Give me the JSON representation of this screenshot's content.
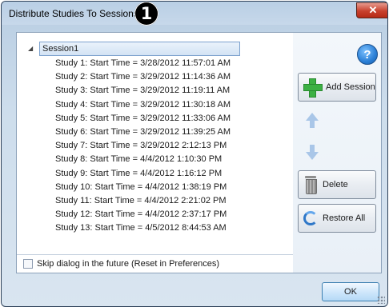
{
  "window": {
    "title": "Distribute Studies To Sessions",
    "badge": "1",
    "close_symbol": "✕"
  },
  "tree": {
    "root_label": "Session1",
    "expander_symbol": "◢",
    "studies": [
      "Study 1: Start Time = 3/28/2012 11:57:01 AM",
      "Study 2: Start Time = 3/29/2012 11:14:36 AM",
      "Study 3: Start Time = 3/29/2012 11:19:11 AM",
      "Study 4: Start Time = 3/29/2012 11:30:18 AM",
      "Study 5: Start Time = 3/29/2012 11:33:06 AM",
      "Study 6: Start Time = 3/29/2012 11:39:25 AM",
      "Study 7: Start Time = 3/29/2012 2:12:13 PM",
      "Study 8: Start Time = 4/4/2012 1:10:30 PM",
      "Study 9: Start Time = 4/4/2012 1:16:12 PM",
      "Study 10: Start Time = 4/4/2012 1:38:19 PM",
      "Study 11: Start Time = 4/4/2012 2:21:02 PM",
      "Study 12: Start Time = 4/4/2012 2:37:17 PM",
      "Study 13: Start Time = 4/5/2012 8:44:53 AM"
    ]
  },
  "skip_option": {
    "label": "Skip dialog in the future (Reset in Preferences)",
    "checked": false
  },
  "actions": {
    "help_symbol": "?",
    "add_session": "Add Session",
    "delete": "Delete",
    "restore_all": "Restore All",
    "ok": "OK"
  },
  "icons": {
    "help": "help-icon",
    "add": "plus-icon",
    "move_up": "arrow-up-icon",
    "move_down": "arrow-down-icon",
    "delete": "trash-icon",
    "restore": "restore-icon",
    "close": "close-icon"
  },
  "colors": {
    "accent": "#3cb043",
    "selection": "#d3e3f4",
    "close": "#c8402c"
  }
}
